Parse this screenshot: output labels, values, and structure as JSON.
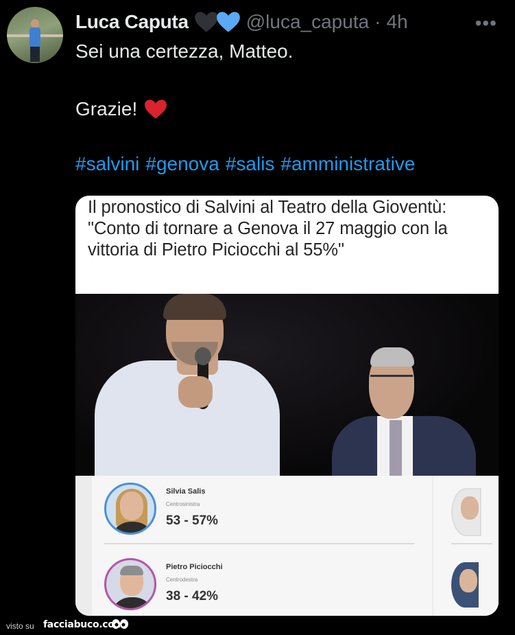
{
  "tweet": {
    "author_name": "Luca Caputa",
    "handle": "@luca_caputa",
    "separator": "·",
    "time": "4h",
    "more_label": "•••",
    "line1": "Sei una certezza, Matteo.",
    "line2": "Grazie!",
    "hashtags": [
      "#salvini",
      "#genova",
      "#salis",
      "#amministrative"
    ]
  },
  "card": {
    "title": "Il pronostico di Salvini al Teatro della Gioventù: \"Conto di tornare a Genova il 27 maggio con la vittoria di Pietro Piciocchi al 55%\"",
    "candidates": [
      {
        "name": "Silvia Salis",
        "party": "Centrosinistra",
        "range": "53 - 57%"
      },
      {
        "name": "Pietro Piciocchi",
        "party": "Centrodestra",
        "range": "38 - 42%"
      }
    ]
  },
  "footer": {
    "visto_label": "visto su",
    "brand": "facciabuco.com"
  },
  "colors": {
    "background": "#000000",
    "text": "#e7e9ea",
    "secondary": "#71767b",
    "hashtag": "#1d9bf0",
    "heart_black": "#2f3336",
    "heart_blue": "#5aa9f4",
    "heart_red": "#d9232d"
  },
  "icons": [
    "black-heart-icon",
    "blue-heart-icon",
    "red-heart-icon",
    "more-options-icon",
    "eyes-logo-icon"
  ]
}
